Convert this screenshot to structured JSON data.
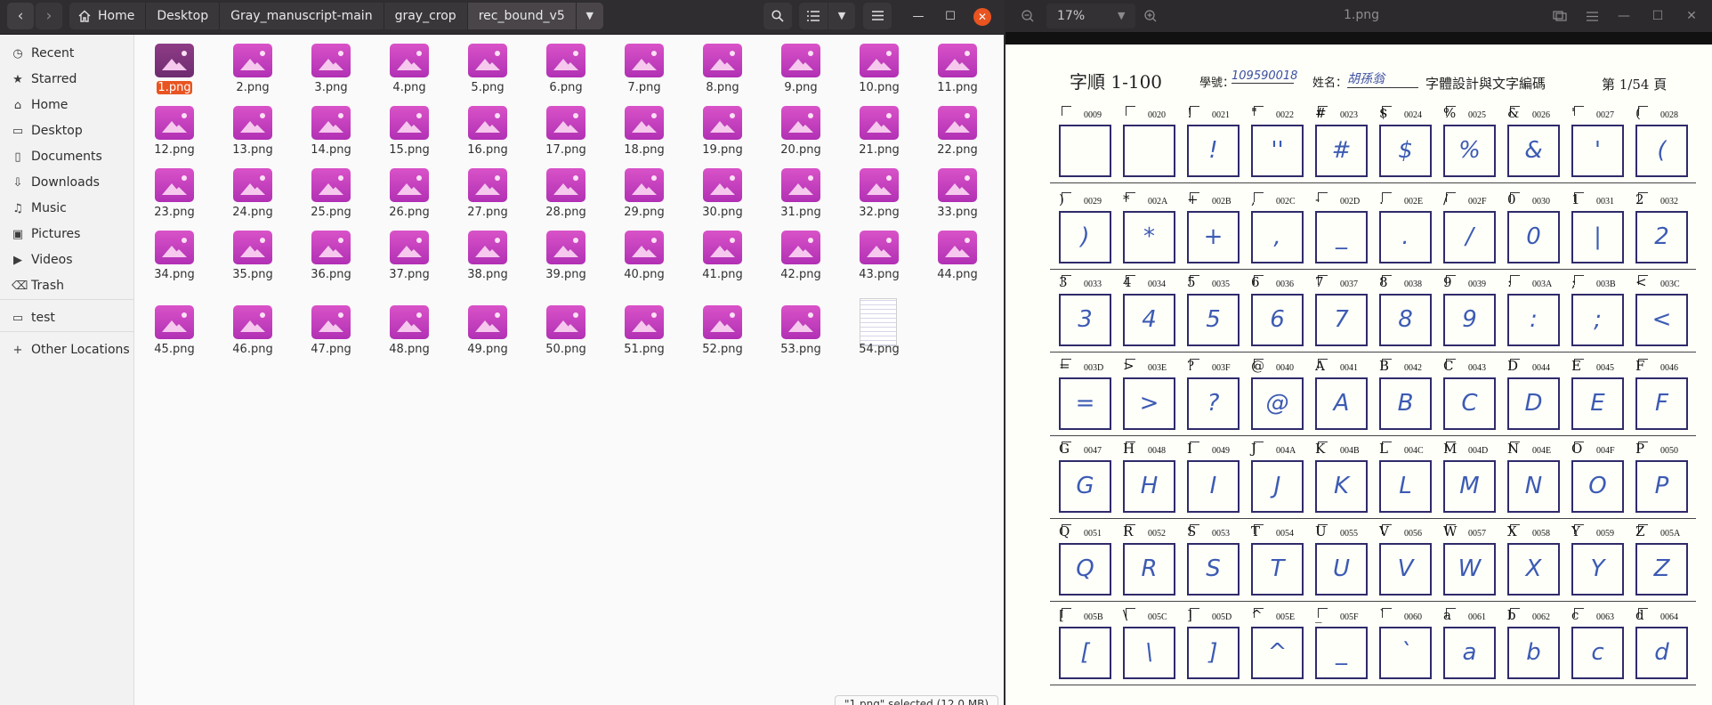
{
  "file_manager": {
    "nav": {
      "back_icon": "‹",
      "forward_icon": "›"
    },
    "breadcrumbs": [
      "Home",
      "Desktop",
      "Gray_manuscript-main",
      "gray_crop",
      "rec_bound_v5"
    ],
    "sidebar": [
      {
        "label": "Recent",
        "icon": "clock-icon"
      },
      {
        "label": "Starred",
        "icon": "star-icon"
      },
      {
        "label": "Home",
        "icon": "home-icon"
      },
      {
        "label": "Desktop",
        "icon": "desktop-icon"
      },
      {
        "label": "Documents",
        "icon": "document-icon"
      },
      {
        "label": "Downloads",
        "icon": "download-icon"
      },
      {
        "label": "Music",
        "icon": "music-icon"
      },
      {
        "label": "Pictures",
        "icon": "pictures-icon"
      },
      {
        "label": "Videos",
        "icon": "video-icon"
      },
      {
        "label": "Trash",
        "icon": "trash-icon"
      },
      {
        "label": "test",
        "icon": "folder-icon"
      },
      {
        "label": "Other Locations",
        "icon": "plus-icon"
      }
    ],
    "files": [
      "1.png",
      "2.png",
      "3.png",
      "4.png",
      "5.png",
      "6.png",
      "7.png",
      "8.png",
      "9.png",
      "10.png",
      "11.png",
      "12.png",
      "13.png",
      "14.png",
      "15.png",
      "16.png",
      "17.png",
      "18.png",
      "19.png",
      "20.png",
      "21.png",
      "22.png",
      "23.png",
      "24.png",
      "25.png",
      "26.png",
      "27.png",
      "28.png",
      "29.png",
      "30.png",
      "31.png",
      "32.png",
      "33.png",
      "34.png",
      "35.png",
      "36.png",
      "37.png",
      "38.png",
      "39.png",
      "40.png",
      "41.png",
      "42.png",
      "43.png",
      "44.png",
      "45.png",
      "46.png",
      "47.png",
      "48.png",
      "49.png",
      "50.png",
      "51.png",
      "52.png",
      "53.png",
      "54.png"
    ],
    "selected_file": "1.png",
    "status": "\"1.png\" selected  (12.0 MB)",
    "accent_color": "#e95420"
  },
  "image_viewer": {
    "zoom": "17%",
    "title": "1.png",
    "document": {
      "title": "字順 1-100",
      "student_id_label": "學號：",
      "student_id": "109590018",
      "name_label": "姓名：",
      "name": "胡孫翁",
      "course": "字體設計與文字編碼",
      "page": "第 1/54 頁",
      "rows": [
        [
          [
            "",
            "0009",
            ""
          ],
          [
            "",
            "0020",
            ""
          ],
          [
            "!",
            "0021",
            "!"
          ],
          [
            "\"",
            "0022",
            "''"
          ],
          [
            "#",
            "0023",
            "#"
          ],
          [
            "$",
            "0024",
            "$"
          ],
          [
            "%",
            "0025",
            "%"
          ],
          [
            "&",
            "0026",
            "&"
          ],
          [
            "'",
            "0027",
            "'"
          ],
          [
            "(",
            "0028",
            "("
          ]
        ],
        [
          [
            ")",
            "0029",
            ")"
          ],
          [
            "*",
            "002A",
            "*"
          ],
          [
            "+",
            "002B",
            "+"
          ],
          [
            ",",
            "002C",
            ","
          ],
          [
            "-",
            "002D",
            "_"
          ],
          [
            ".",
            "002E",
            "."
          ],
          [
            "/",
            "002F",
            "/"
          ],
          [
            "0",
            "0030",
            "0"
          ],
          [
            "1",
            "0031",
            "|"
          ],
          [
            "2",
            "0032",
            "2"
          ]
        ],
        [
          [
            "3",
            "0033",
            "3"
          ],
          [
            "4",
            "0034",
            "4"
          ],
          [
            "5",
            "0035",
            "5"
          ],
          [
            "6",
            "0036",
            "6"
          ],
          [
            "7",
            "0037",
            "7"
          ],
          [
            "8",
            "0038",
            "8"
          ],
          [
            "9",
            "0039",
            "9"
          ],
          [
            ":",
            "003A",
            ":"
          ],
          [
            ";",
            "003B",
            ";"
          ],
          [
            "<",
            "003C",
            "<"
          ]
        ],
        [
          [
            "=",
            "003D",
            "="
          ],
          [
            ">",
            "003E",
            ">"
          ],
          [
            "?",
            "003F",
            "?"
          ],
          [
            "@",
            "0040",
            "@"
          ],
          [
            "A",
            "0041",
            "A"
          ],
          [
            "B",
            "0042",
            "B"
          ],
          [
            "C",
            "0043",
            "C"
          ],
          [
            "D",
            "0044",
            "D"
          ],
          [
            "E",
            "0045",
            "E"
          ],
          [
            "F",
            "0046",
            "F"
          ]
        ],
        [
          [
            "G",
            "0047",
            "G"
          ],
          [
            "H",
            "0048",
            "H"
          ],
          [
            "I",
            "0049",
            "I"
          ],
          [
            "J",
            "004A",
            "J"
          ],
          [
            "K",
            "004B",
            "K"
          ],
          [
            "L",
            "004C",
            "L"
          ],
          [
            "M",
            "004D",
            "M"
          ],
          [
            "N",
            "004E",
            "N"
          ],
          [
            "O",
            "004F",
            "O"
          ],
          [
            "P",
            "0050",
            "P"
          ]
        ],
        [
          [
            "Q",
            "0051",
            "Q"
          ],
          [
            "R",
            "0052",
            "R"
          ],
          [
            "S",
            "0053",
            "S"
          ],
          [
            "T",
            "0054",
            "T"
          ],
          [
            "U",
            "0055",
            "U"
          ],
          [
            "V",
            "0056",
            "V"
          ],
          [
            "W",
            "0057",
            "W"
          ],
          [
            "X",
            "0058",
            "X"
          ],
          [
            "Y",
            "0059",
            "Y"
          ],
          [
            "Z",
            "005A",
            "Z"
          ]
        ],
        [
          [
            "[",
            "005B",
            "["
          ],
          [
            "\\",
            "005C",
            "\\"
          ],
          [
            "]",
            "005D",
            "]"
          ],
          [
            "^",
            "005E",
            "^"
          ],
          [
            "_",
            "005F",
            "_"
          ],
          [
            "`",
            "0060",
            "`"
          ],
          [
            "a",
            "0061",
            "a"
          ],
          [
            "b",
            "0062",
            "b"
          ],
          [
            "c",
            "0063",
            "c"
          ],
          [
            "d",
            "0064",
            "d"
          ]
        ]
      ]
    }
  }
}
